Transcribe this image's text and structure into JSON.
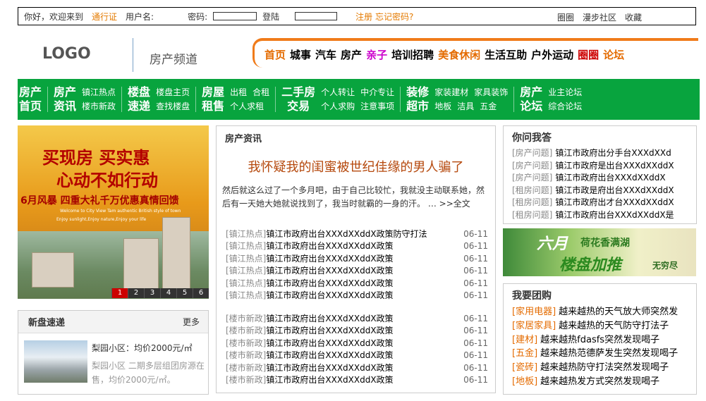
{
  "topbar": {
    "greeting": "你好，欢迎来到",
    "passport": "通行证",
    "username_label": "用户名:",
    "password_label": "密码:",
    "login": "登陆",
    "register_forgot": "注册 忘记密码?",
    "links": [
      "圈圈",
      "漫步社区",
      "收藏"
    ]
  },
  "header": {
    "logo": "LOGO",
    "channel": "房产频道",
    "nav": [
      {
        "label": "首页",
        "color": "#e46b00"
      },
      {
        "label": "城事",
        "color": "#000000"
      },
      {
        "label": "汽车",
        "color": "#000000"
      },
      {
        "label": "房产",
        "color": "#000000"
      },
      {
        "label": "亲子",
        "color": "#cc00cc"
      },
      {
        "label": "培训招聘",
        "color": "#000000"
      },
      {
        "label": "美食休闲",
        "color": "#e46b00"
      },
      {
        "label": "生活互助",
        "color": "#000000"
      },
      {
        "label": "户外运动",
        "color": "#000000"
      },
      {
        "label": "圈圈",
        "color": "#cc0000"
      },
      {
        "label": "论坛",
        "color": "#e46b00"
      }
    ]
  },
  "greennav": [
    {
      "big": [
        "房产",
        "首页"
      ],
      "sub": []
    },
    {
      "big": [
        "房产",
        "资讯"
      ],
      "sub": [
        [
          "镇江热点"
        ],
        [
          "楼市新政"
        ]
      ]
    },
    {
      "big": [
        "楼盘",
        "速递"
      ],
      "sub": [
        [
          "楼盘主页"
        ],
        [
          "查找楼盘"
        ]
      ]
    },
    {
      "big": [
        "房屋",
        "租售"
      ],
      "sub": [
        [
          "出租",
          "合租"
        ],
        [
          "个人求租"
        ]
      ]
    },
    {
      "big": [
        "二手房",
        "交易"
      ],
      "sub": [
        [
          "个人转让",
          "中介专让"
        ],
        [
          "个人求购",
          "注意事项"
        ]
      ]
    },
    {
      "big": [
        "装修",
        "超市"
      ],
      "sub": [
        [
          "家装建材",
          "家具装饰"
        ],
        [
          "地板",
          "洁具",
          "五金"
        ]
      ]
    },
    {
      "big": [
        "房产",
        "论坛"
      ],
      "sub": [
        [
          "业主论坛"
        ],
        [
          "综合论坛"
        ]
      ]
    }
  ],
  "banner": {
    "line1": "买现房 买实惠",
    "line2": "心动不如行动",
    "line3": "6月风暴 四重大礼千万优惠真情回馈",
    "line4": "Welcome to City View Tam authentic British style of town",
    "line5": "Enjoy sunlight,Enjoy nature,Enjoy your life",
    "pages": [
      "1",
      "2",
      "3",
      "4",
      "5",
      "6"
    ],
    "active_page": "1"
  },
  "newhouse": {
    "title": "新盘速递",
    "more": "更多",
    "name": "梨园小区：均价2000元/㎡",
    "desc": "梨园小区 二期多层组团房源在售，均价2000元/㎡。"
  },
  "news": {
    "title": "房产资讯",
    "headline": "我怀疑我的闺蜜被世纪佳缘的男人骗了",
    "summary": "然后就这么过了一个多月吧，由于自己比较忙，我就没主动联系她，然后有一天她大她就说找到了，我当时就霸的一身的汗。 …",
    "more": ">>全文",
    "hot": [
      {
        "tag": "[镇江热点]",
        "title": "镇江市政府出台XXXdXXddX政策防守打法",
        "date": "06-11"
      },
      {
        "tag": "[镇江热点]",
        "title": "镇江市政府出台XXXdXXddX政策",
        "date": "06-11"
      },
      {
        "tag": "[镇江热点]",
        "title": "镇江市政府出台XXXdXXddX政策",
        "date": "06-11"
      },
      {
        "tag": "[镇江热点]",
        "title": "镇江市政府出台XXXdXXddX政策",
        "date": "06-11"
      },
      {
        "tag": "[镇江热点]",
        "title": "镇江市政府出台XXXdXXddX政策",
        "date": "06-11"
      },
      {
        "tag": "[镇江热点]",
        "title": "镇江市政府出台XXXdXXddX政策",
        "date": "06-11"
      }
    ],
    "policy": [
      {
        "tag": "[楼市新政]",
        "title": "镇江市政府出台XXXdXXddX政策",
        "date": "06-11"
      },
      {
        "tag": "[楼市新政]",
        "title": "镇江市政府出台XXXdXXddX政策",
        "date": "06-11"
      },
      {
        "tag": "[楼市新政]",
        "title": "镇江市政府出台XXXdXXddX政策",
        "date": "06-11"
      },
      {
        "tag": "[楼市新政]",
        "title": "镇江市政府出台XXXdXXddX政策",
        "date": "06-11"
      },
      {
        "tag": "[楼市新政]",
        "title": "镇江市政府出台XXXdXXddX政策",
        "date": "06-11"
      },
      {
        "tag": "[楼市新政]",
        "title": "镇江市政府出台XXXdXXddX政策",
        "date": "06-11"
      }
    ]
  },
  "ask": {
    "title": "你问我答",
    "items": [
      {
        "tag": "[房产问题]",
        "title": "镇江市政府出分手台XXXdXXd"
      },
      {
        "tag": "[房产问题]",
        "title": "镇江市政府是出台XXXdXXddX"
      },
      {
        "tag": "[房产问题]",
        "title": "镇江市政府出台XXXdXXddX"
      },
      {
        "tag": "[租房问题]",
        "title": "镇江市政是府出台XXXdXXddX"
      },
      {
        "tag": "[租房问题]",
        "title": "镇江市政府出才台XXXdXXddX"
      },
      {
        "tag": "[租房问题]",
        "title": "镇江市政府出台XXXdXXddX是"
      }
    ]
  },
  "ad": {
    "a1": "六月",
    "a2": "荷花香满湖",
    "a3": "楼盘加推",
    "a4": "无穷尽"
  },
  "group": {
    "title": "我要团购",
    "items": [
      {
        "tag": "[家用电器]",
        "title": "越来越热的天气放大师突然发"
      },
      {
        "tag": "[家居家具]",
        "title": "越来越热的天气防守打法子"
      },
      {
        "tag": "[建材]",
        "title": "越来越热fdasfs突然发现喝子"
      },
      {
        "tag": "[五金]",
        "title": "越来越热范德萨发生突然发现喝子"
      },
      {
        "tag": "[瓷砖]",
        "title": "越来越热防守打法突然发现喝子"
      },
      {
        "tag": "[地板]",
        "title": "越来越热发方式突然发现喝子"
      }
    ]
  }
}
